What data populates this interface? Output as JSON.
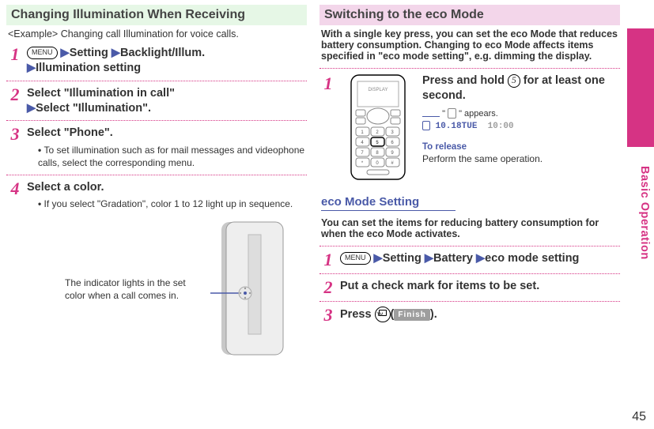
{
  "side_label": "Basic Operation",
  "page_number": "45",
  "left": {
    "title": "Changing Illumination When Receiving",
    "example": "<Example> Changing call Illumination for voice calls.",
    "steps": [
      {
        "num": "1",
        "menu_label": "MENU",
        "parts": [
          "Setting",
          "Backlight/Illum.",
          "Illumination setting"
        ]
      },
      {
        "num": "2",
        "line1": "Select \"Illumination in call\"",
        "line2": "Select \"Illumination\"."
      },
      {
        "num": "3",
        "line1": "Select \"Phone\".",
        "sub": "To set illumination such as for mail messages and videophone calls, select the corresponding menu."
      },
      {
        "num": "4",
        "line1": "Select a color.",
        "sub": "If you select \"Gradation\", color 1 to 12 light up in sequence."
      }
    ],
    "caption": "The indicator lights in the set color when a call comes in."
  },
  "right": {
    "title": "Switching to the eco Mode",
    "intro": "With a single key press, you can set the eco Mode that reduces battery consumption. Changing to eco Mode affects items specified in \"eco mode setting\", e.g. dimming the display.",
    "hold_step_num": "1",
    "hold_text_a": "Press and hold ",
    "hold_key": "5",
    "hold_text_b": " for at least one second.",
    "appears_a": "\" ",
    "appears_b": " \" appears.",
    "datetime_date": "10.18TUE",
    "datetime_time": "10:00",
    "release_title": "To release",
    "release_sub": "Perform the same operation.",
    "sub_title": "eco Mode Setting",
    "sub_intro": "You can set the items for reducing battery consumption for when the eco Mode activates.",
    "menu_label": "MENU",
    "eco_steps": {
      "s1": {
        "num": "1",
        "parts": [
          "Setting",
          "Battery",
          "eco mode setting"
        ]
      },
      "s2": {
        "num": "2",
        "text": "Put a check mark for items to be set."
      },
      "s3": {
        "num": "3",
        "preset": "Press ",
        "finish": "Finish",
        "post": "."
      }
    }
  }
}
